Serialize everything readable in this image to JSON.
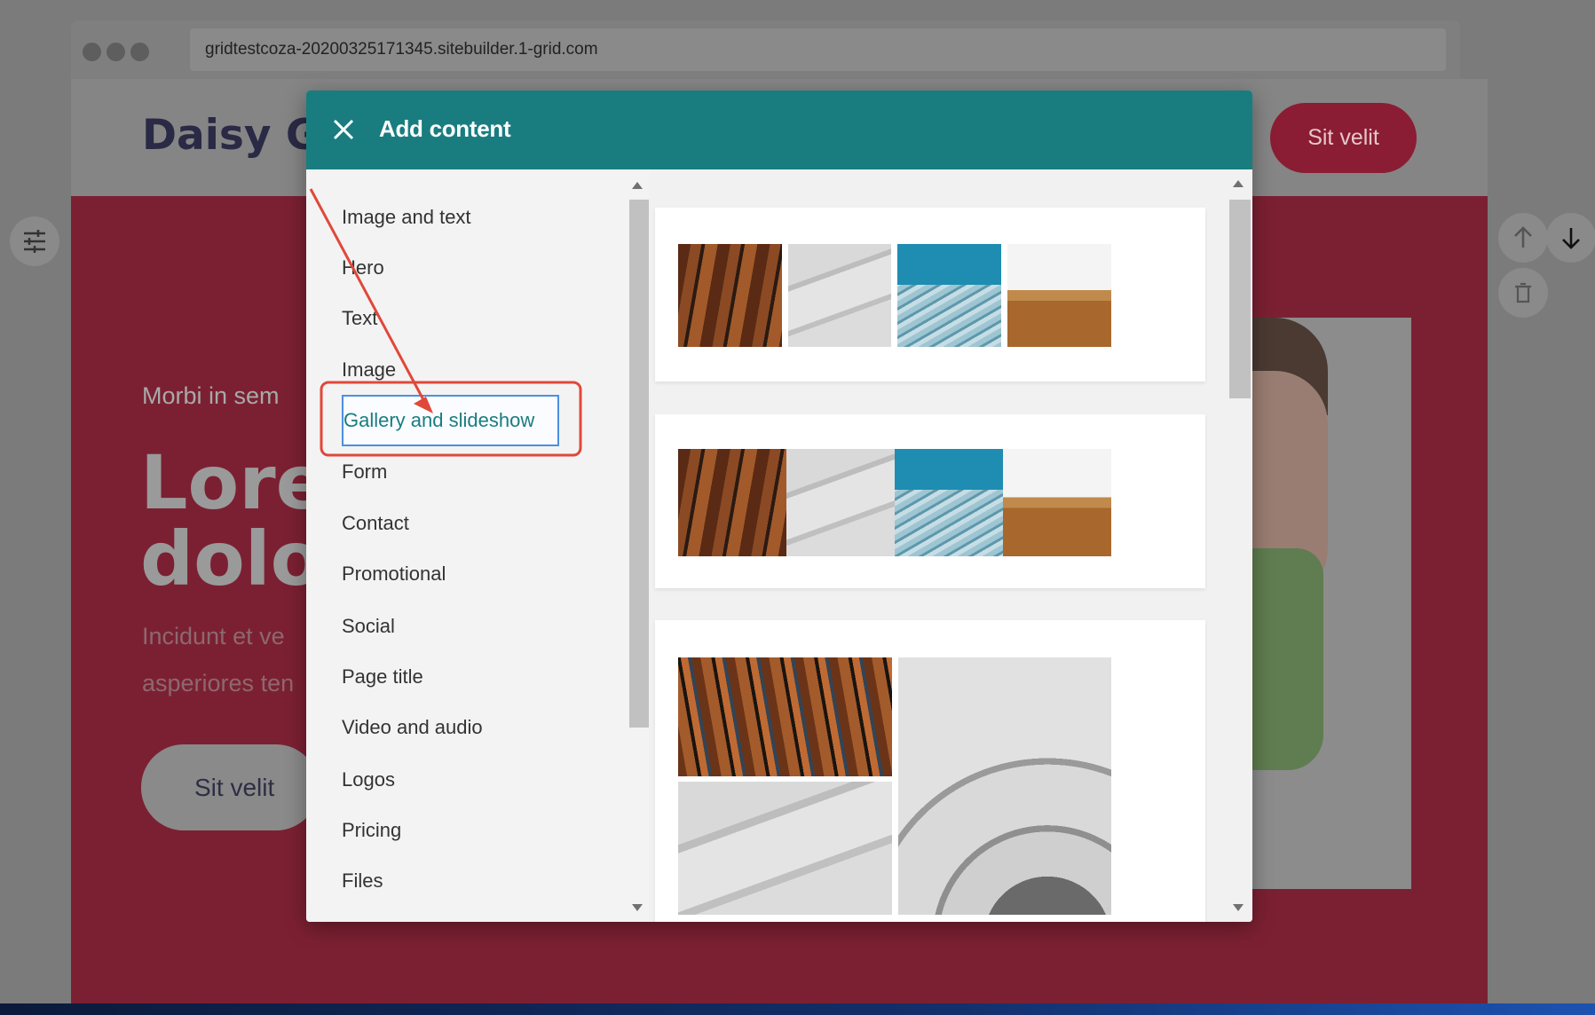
{
  "browser": {
    "url": "gridtestcoza-20200325171345.sitebuilder.1-grid.com"
  },
  "site": {
    "brand": "Daisy Ga",
    "header_button": "Sit velit",
    "hero_subtitle": "Morbi in sem",
    "hero_title_line1": "Lore",
    "hero_title_line2": "dolo",
    "hero_text_line1": "Incidunt et ve",
    "hero_text_line2": "asperiores ten",
    "hero_button": "Sit velit"
  },
  "modal": {
    "title": "Add content",
    "categories": [
      {
        "label": "Image and text"
      },
      {
        "label": "Hero"
      },
      {
        "label": "Text"
      },
      {
        "label": "Image"
      },
      {
        "label": "Gallery and slideshow",
        "selected": true
      },
      {
        "label": "Form"
      },
      {
        "label": "Contact"
      },
      {
        "label": "Promotional"
      },
      {
        "label": "Social"
      },
      {
        "label": "Page title"
      },
      {
        "label": "Video and audio"
      },
      {
        "label": "Logos"
      },
      {
        "label": "Pricing"
      },
      {
        "label": "Files"
      }
    ]
  },
  "colors": {
    "modal_header": "#197d80",
    "selected_text": "#197d80",
    "highlight_box": "#e0483a",
    "annotation_arrow": "#e0483a"
  },
  "icons": {
    "close": "close-icon",
    "settings": "sliders-icon",
    "move_up": "arrow-up-icon",
    "move_down": "arrow-down-icon",
    "delete": "trash-icon"
  }
}
